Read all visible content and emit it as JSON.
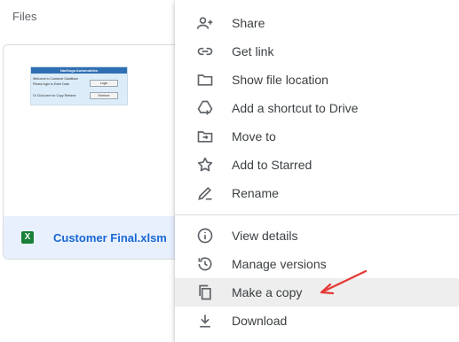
{
  "files_section": {
    "heading": "Files",
    "file": {
      "name": "Customer Final.xlsm",
      "type_icon": "excel-icon",
      "type_letter": "X",
      "thumbnail": {
        "header": "NavSoga Automobiles",
        "line1": "Welcome to Customer DataBase",
        "line2": "Please login to Enter  Data",
        "line3": "Or Click here for Copy Retrieve",
        "button1": "Login",
        "button2": "Retrieve"
      }
    }
  },
  "context_menu": {
    "items": [
      {
        "label": "Share",
        "icon": "person-add-icon"
      },
      {
        "label": "Get link",
        "icon": "link-icon"
      },
      {
        "label": "Show file location",
        "icon": "folder-icon"
      },
      {
        "label": "Add a shortcut to Drive",
        "icon": "add-shortcut-icon"
      },
      {
        "label": "Move to",
        "icon": "move-to-folder-icon"
      },
      {
        "label": "Add to Starred",
        "icon": "star-icon"
      },
      {
        "label": "Rename",
        "icon": "pencil-icon"
      },
      {
        "label": "View details",
        "icon": "info-icon"
      },
      {
        "label": "Manage versions",
        "icon": "history-icon"
      },
      {
        "label": "Make a copy",
        "icon": "copy-icon",
        "highlighted": true
      },
      {
        "label": "Download",
        "icon": "download-icon"
      }
    ]
  },
  "annotation": {
    "arrow_color": "#e53935"
  },
  "colors": {
    "accent_blue": "#1967d2",
    "selected_bg": "#e8f0fe",
    "excel_green": "#188038",
    "menu_text": "#3c4043",
    "icon_gray": "#5f6368",
    "highlight_bg": "#eeeeee"
  }
}
